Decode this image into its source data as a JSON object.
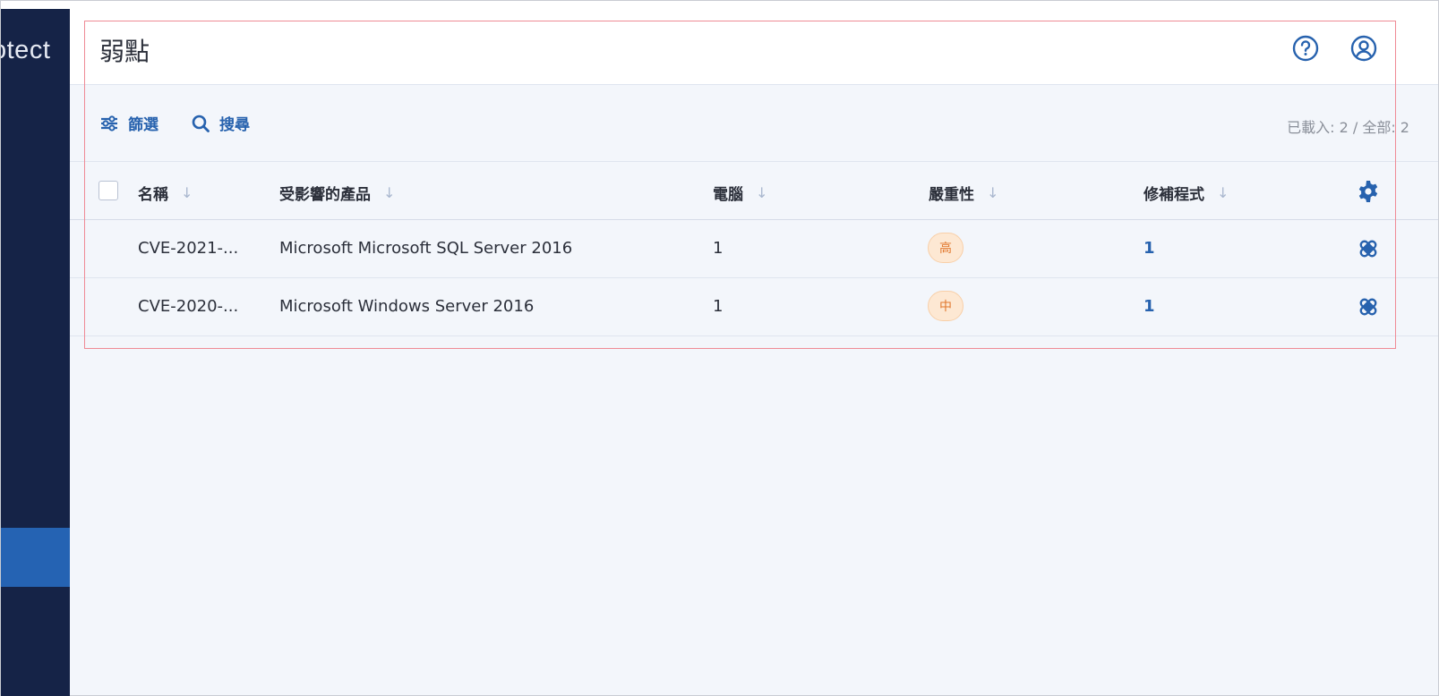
{
  "sidebar": {
    "brand_fragment": "otect"
  },
  "header": {
    "title": "弱點"
  },
  "toolbar": {
    "filter_label": "篩選",
    "search_label": "搜尋",
    "loaded_count": "已載入: 2 / 全部: 2"
  },
  "table": {
    "columns": [
      {
        "label": "名稱",
        "sort": "↓"
      },
      {
        "label": "受影響的產品",
        "sort": "↓"
      },
      {
        "label": "電腦",
        "sort": "↓"
      },
      {
        "label": "嚴重性",
        "sort": "↓"
      },
      {
        "label": "修補程式",
        "sort": "↓"
      }
    ],
    "rows": [
      {
        "name": "CVE-2021-...",
        "product": "Microsoft Microsoft SQL Server 2016",
        "computers": "1",
        "severity": "高",
        "patches": "1"
      },
      {
        "name": "CVE-2020-...",
        "product": "Microsoft Windows Server 2016",
        "computers": "1",
        "severity": "中",
        "patches": "1"
      }
    ]
  },
  "colors": {
    "sidebar_bg": "#152347",
    "sidebar_active": "#2563b3",
    "accent": "#2762ae",
    "severity_badge_bg": "#fde8d3",
    "severity_badge_text": "#e1782e",
    "focus_outline": "#ef8a95"
  },
  "icons": [
    "help-icon",
    "user-icon",
    "filter-icon",
    "search-icon",
    "settings-gear-icon",
    "patch-icon"
  ]
}
